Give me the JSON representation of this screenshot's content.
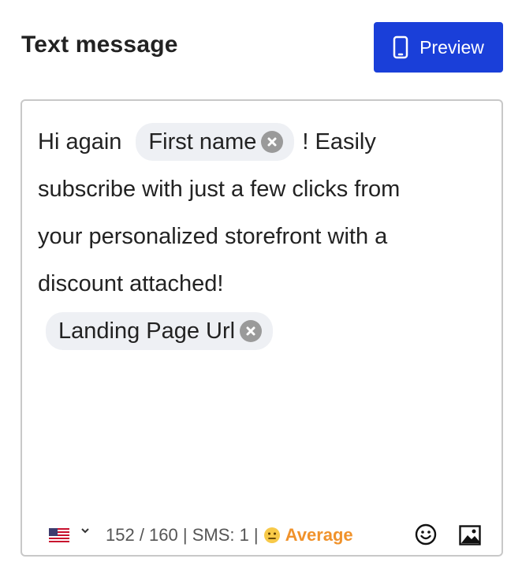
{
  "header": {
    "title": "Text message",
    "preview_label": "Preview"
  },
  "message": {
    "line1_text_before": "Hi again",
    "first_name_chip": "First name",
    "line1_text_after": "! Easily",
    "line2": "subscribe with just a few clicks from",
    "line3": "your personalized storefront with a",
    "line4": "discount attached!",
    "landing_chip": "Landing Page Url"
  },
  "footer": {
    "counter": "152 / 160 | SMS: 1 |",
    "quality_label": "Average",
    "icons": [
      "us-flag-icon",
      "chevron-down-icon",
      "neutral-face-icon",
      "smiley-icon",
      "image-icon"
    ]
  },
  "colors": {
    "accent": "#1a3fd9",
    "average": "#f0922b",
    "chip_bg": "#eef0f4"
  }
}
